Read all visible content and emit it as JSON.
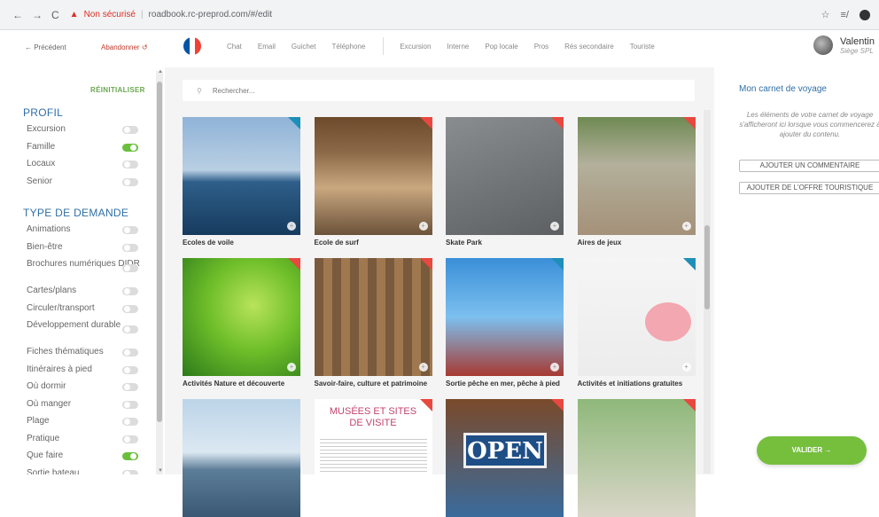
{
  "browser": {
    "nav": [
      "←",
      "→",
      "C"
    ],
    "security": "Non sécurisé",
    "url": "roadbook.rc-preprod.com/#/edit"
  },
  "header": {
    "prev": "← Précédent",
    "abandon": "Abandonner ↺",
    "flag_colors": [
      "#0055a4",
      "#ffffff",
      "#ef4135"
    ],
    "tabs_left": [
      "Chat",
      "Email",
      "Guichet",
      "Téléphone"
    ],
    "tabs_right": [
      "Excursion",
      "Interne",
      "Pop locale",
      "Pros",
      "Rés secondaire",
      "Touriste"
    ],
    "user_name": "Valentin",
    "user_role": "Siège SPL"
  },
  "sidebar": {
    "reset": "RÉINITIALISER",
    "profil_title": "PROFIL",
    "profil": [
      {
        "label": "Excursion",
        "on": false
      },
      {
        "label": "Famille",
        "on": true
      },
      {
        "label": "Locaux",
        "on": false
      },
      {
        "label": "Senior",
        "on": false
      }
    ],
    "demande_title": "TYPE DE DEMANDE",
    "demande": [
      {
        "label": "Animations",
        "on": false
      },
      {
        "label": "Bien-être",
        "on": false
      },
      {
        "label": "Brochures numériques DIDR",
        "on": false
      },
      {
        "label": "Cartes/plans",
        "on": false
      },
      {
        "label": "Circuler/transport",
        "on": false
      },
      {
        "label": "Développement durable",
        "on": false
      },
      {
        "label": "Fiches thématiques",
        "on": false
      },
      {
        "label": "Itinéraires à pied",
        "on": false
      },
      {
        "label": "Où dormir",
        "on": false
      },
      {
        "label": "Où manger",
        "on": false
      },
      {
        "label": "Plage",
        "on": false
      },
      {
        "label": "Pratique",
        "on": false
      },
      {
        "label": "Que faire",
        "on": true
      },
      {
        "label": "Sortie bateau",
        "on": false
      }
    ]
  },
  "search": {
    "icon": "search-icon",
    "placeholder": "Rechercher..."
  },
  "cards": [
    {
      "label": "Ecoles de voile",
      "corner": "blue"
    },
    {
      "label": "Ecole de surf",
      "corner": "red"
    },
    {
      "label": "Skate Park",
      "corner": "red"
    },
    {
      "label": "Aires de jeux",
      "corner": "red"
    },
    {
      "label": "Activités Nature et découverte",
      "corner": "red"
    },
    {
      "label": "Savoir-faire, culture et patrimoine",
      "corner": "red"
    },
    {
      "label": "Sortie pêche en mer, pêche à pied",
      "corner": "blue"
    },
    {
      "label": "Activités et initiations gratuites",
      "corner": "blue"
    },
    {
      "label": "",
      "corner": "none"
    },
    {
      "label": "",
      "corner": "red"
    },
    {
      "label": "",
      "corner": "red"
    },
    {
      "label": "",
      "corner": "red"
    }
  ],
  "musee_text": "MUSÉES ET SITES DE VISITE",
  "open_sign": "OPEN",
  "right": {
    "title": "Mon carnet de voyage",
    "desc": "Les éléments de votre carnet de voyage s'afficheront ici lorsque vous commencerez à ajouter du contenu.",
    "btn_comment": "AJOUTER UN COMMENTAIRE",
    "btn_offer": "AJOUTER DE L'OFFRE TOURISTIQUE",
    "btn_validate": "VALIDER →"
  },
  "colors": {
    "accent_blue": "#2f6fa6",
    "toggle_on": "#6abf3b",
    "valider": "#75bf3d",
    "corner_red": "#e8483f",
    "corner_blue": "#1e8fb8"
  }
}
